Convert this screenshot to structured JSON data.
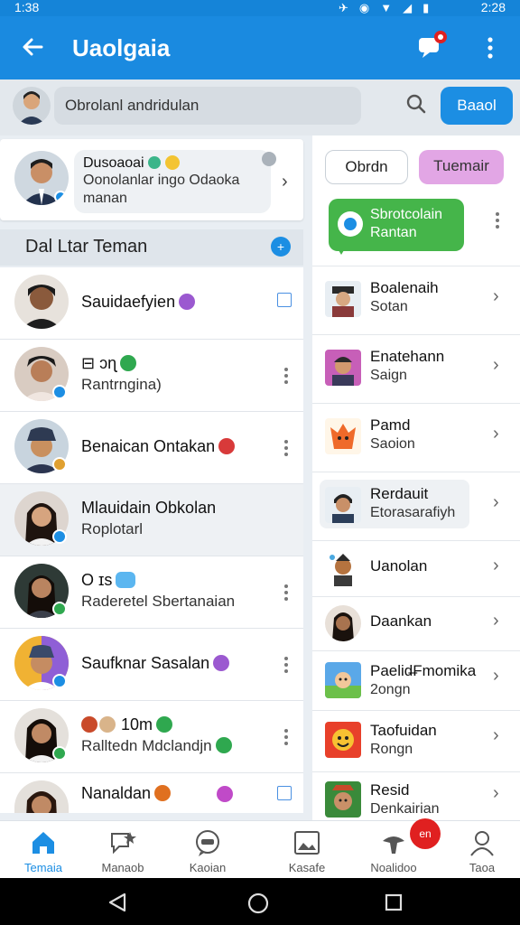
{
  "status_bar": {
    "time": "1:38",
    "right_time": "2:28"
  },
  "app_bar": {
    "title": "Uaolgaia",
    "chat_badge": ""
  },
  "search": {
    "placeholder": "Obrolanl andridulan",
    "button_label": "Baaol"
  },
  "profile": {
    "name": "Dusoaoai",
    "message": "Oonolanlar ingo Odaoka manan"
  },
  "section": {
    "label": "Dal  Ltar Teman"
  },
  "friends": [
    {
      "name": "Sauidaefyien",
      "sub": "",
      "avatar_color": "#5a3a2a"
    },
    {
      "name": "⊟ ɔɳ",
      "sub": "Rantrngina)",
      "avatar_color": "#3a2a1e"
    },
    {
      "name": "Benaican Ontakan",
      "sub": "",
      "avatar_color": "#4a3a2a"
    },
    {
      "name": "Mlauidain Obkolan",
      "sub": "Roplotarl",
      "avatar_color": "#2a1a12"
    },
    {
      "name": "O ɪs",
      "sub": "Raderetel Sbertanaian",
      "avatar_color": "#3a2418"
    },
    {
      "name": "Saufknar Sasalan",
      "sub": "",
      "avatar_color": "#4a2e20"
    },
    {
      "name": "10m",
      "sub": "Ralltedn Mdclandjn",
      "avatar_color": "#2e1e14"
    },
    {
      "name": "Nanaldan",
      "sub": "",
      "avatar_color": "#3a2416"
    }
  ],
  "tabs": {
    "tab1": "Obrdn",
    "tab2": "Tuemair"
  },
  "suggestion": {
    "text": "Sbrotcolain Rantan"
  },
  "right_list": [
    {
      "title": "Boalenaih",
      "sub": "Sotan"
    },
    {
      "title": "Enatehann",
      "sub": "Saign"
    },
    {
      "title": "Pamd",
      "sub": "Saoion"
    },
    {
      "title": "Rerdauit",
      "sub": "Etorasarafiyh"
    },
    {
      "title": "Uanolan",
      "sub": ""
    },
    {
      "title": "Daankan",
      "sub": ""
    },
    {
      "title": "Paelid̶Fmomika",
      "sub": "2ongn"
    },
    {
      "title": "Taofuidan",
      "sub": "Rongn"
    },
    {
      "title": "Resid",
      "sub": "Denkairian"
    }
  ],
  "bottom_nav": [
    {
      "label": "Temaia",
      "icon": "home-icon"
    },
    {
      "label": "Manaob",
      "icon": "star-chat-icon"
    },
    {
      "label": "Kaoian",
      "icon": "message-icon"
    },
    {
      "label": "Kasafe",
      "icon": "image-icon"
    },
    {
      "label": "Noalidoo",
      "icon": "bell-icon"
    },
    {
      "label": "Taoa",
      "icon": "user-icon"
    }
  ],
  "notification_badge": "on",
  "colors": {
    "primary": "#1a8ae0",
    "accent_pink": "#e2a6e5",
    "green": "#45b54a",
    "badge_red": "#e02020"
  }
}
